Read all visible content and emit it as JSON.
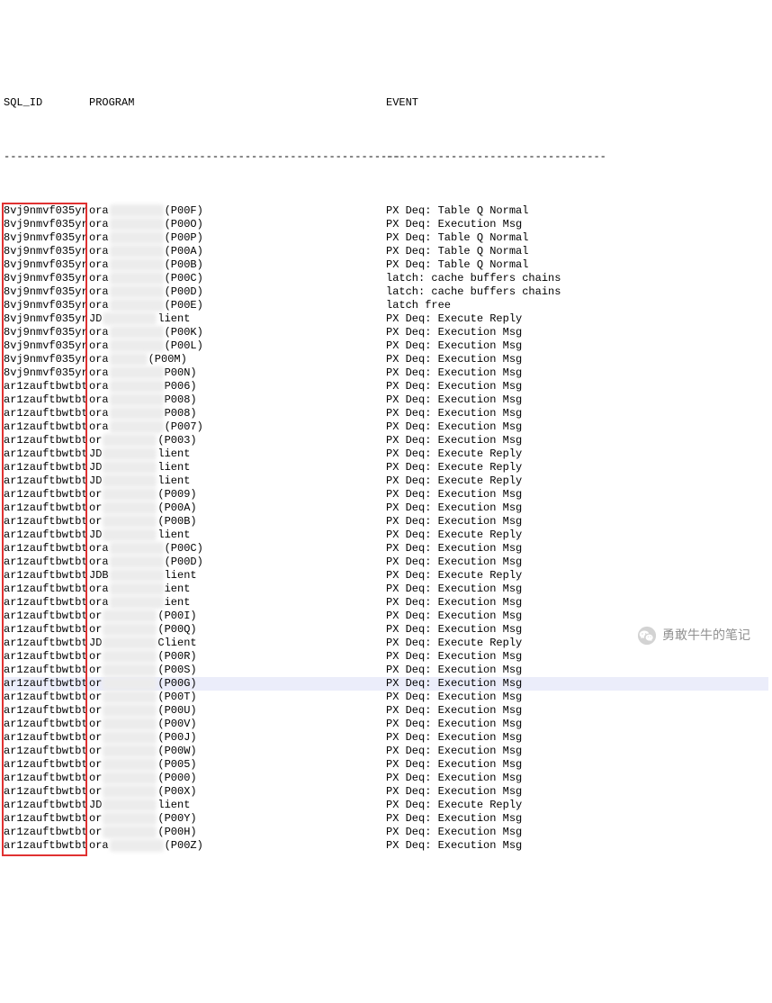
{
  "headers": {
    "sql_id": "SQL_ID",
    "program": "PROGRAM",
    "event": "EVENT"
  },
  "dashes": {
    "sql_id": "-------------",
    "program": "------------------------------------------------",
    "event": "----------------------------------"
  },
  "watermark": "勇敢牛牛的笔记",
  "highlighted_row_index": 35,
  "rows": [
    {
      "sql_id": "8vj9nmvf035yr",
      "prog_left": "ora",
      "prog_mid_type": "blur",
      "prog_right": "(P00F)",
      "event": "PX Deq: Table Q Normal"
    },
    {
      "sql_id": "8vj9nmvf035yr",
      "prog_left": "ora",
      "prog_mid_type": "blur",
      "prog_right": "(P00O)",
      "event": "PX Deq: Execution Msg"
    },
    {
      "sql_id": "8vj9nmvf035yr",
      "prog_left": "ora",
      "prog_mid_type": "blur",
      "prog_right": "(P00P)",
      "event": "PX Deq: Table Q Normal"
    },
    {
      "sql_id": "8vj9nmvf035yr",
      "prog_left": "ora",
      "prog_mid_type": "blur",
      "prog_right": "(P00A)",
      "event": "PX Deq: Table Q Normal"
    },
    {
      "sql_id": "8vj9nmvf035yr",
      "prog_left": "ora",
      "prog_mid_type": "blur",
      "prog_right": "(P00B)",
      "event": "PX Deq: Table Q Normal"
    },
    {
      "sql_id": "8vj9nmvf035yr",
      "prog_left": "ora",
      "prog_mid_type": "blur",
      "prog_right": "(P00C)",
      "event": "latch: cache buffers chains"
    },
    {
      "sql_id": "8vj9nmvf035yr",
      "prog_left": "ora",
      "prog_mid_type": "blur",
      "prog_right": "(P00D)",
      "event": "latch: cache buffers chains"
    },
    {
      "sql_id": "8vj9nmvf035yr",
      "prog_left": "ora",
      "prog_mid_type": "blur",
      "prog_right": "(P00E)",
      "event": "latch free"
    },
    {
      "sql_id": "8vj9nmvf035yr",
      "prog_left": "JD",
      "prog_mid_type": "blur",
      "prog_right": "lient",
      "event": "PX Deq: Execute Reply"
    },
    {
      "sql_id": "8vj9nmvf035yr",
      "prog_left": "ora",
      "prog_mid_type": "blur",
      "prog_right": "(P00K)",
      "event": "PX Deq: Execution Msg"
    },
    {
      "sql_id": "8vj9nmvf035yr",
      "prog_left": "ora",
      "prog_mid_type": "blur",
      "prog_right": "(P00L)",
      "event": "PX Deq: Execution Msg"
    },
    {
      "sql_id": "8vj9nmvf035yr",
      "prog_left": "ora",
      "prog_mid_type": "blur-small",
      "prog_right": "(P00M)",
      "event": "PX Deq: Execution Msg"
    },
    {
      "sql_id": "8vj9nmvf035yr",
      "prog_left": "ora",
      "prog_mid_type": "blur",
      "prog_right": "P00N)",
      "event": "PX Deq: Execution Msg"
    },
    {
      "sql_id": "ar1zauftbwtbt",
      "prog_left": "ora",
      "prog_mid_type": "blur",
      "prog_right": "P006)",
      "event": "PX Deq: Execution Msg"
    },
    {
      "sql_id": "ar1zauftbwtbt",
      "prog_left": "ora",
      "prog_mid_type": "blur",
      "prog_right": "P008)",
      "event": "PX Deq: Execution Msg"
    },
    {
      "sql_id": "ar1zauftbwtbt",
      "prog_left": "ora",
      "prog_mid_type": "blur",
      "prog_right": "P008)",
      "event": "PX Deq: Execution Msg"
    },
    {
      "sql_id": "ar1zauftbwtbt",
      "prog_left": "ora",
      "prog_mid_type": "blur",
      "prog_right": "(P007)",
      "event": "PX Deq: Execution Msg"
    },
    {
      "sql_id": "ar1zauftbwtbt",
      "prog_left": "or",
      "prog_mid_type": "blur",
      "prog_right": "(P003)",
      "event": "PX Deq: Execution Msg"
    },
    {
      "sql_id": "ar1zauftbwtbt",
      "prog_left": "JD",
      "prog_mid_type": "blur",
      "prog_right": "lient",
      "event": "PX Deq: Execute Reply"
    },
    {
      "sql_id": "ar1zauftbwtbt",
      "prog_left": "JD",
      "prog_mid_type": "blur",
      "prog_right": "lient",
      "event": "PX Deq: Execute Reply"
    },
    {
      "sql_id": "ar1zauftbwtbt",
      "prog_left": "JD",
      "prog_mid_type": "blur",
      "prog_right": "lient",
      "event": "PX Deq: Execute Reply"
    },
    {
      "sql_id": "ar1zauftbwtbt",
      "prog_left": "or",
      "prog_mid_type": "blur",
      "prog_right": "(P009)",
      "event": "PX Deq: Execution Msg"
    },
    {
      "sql_id": "ar1zauftbwtbt",
      "prog_left": "or",
      "prog_mid_type": "blur",
      "prog_right": "(P00A)",
      "event": "PX Deq: Execution Msg"
    },
    {
      "sql_id": "ar1zauftbwtbt",
      "prog_left": "or",
      "prog_mid_type": "blur",
      "prog_right": "(P00B)",
      "event": "PX Deq: Execution Msg"
    },
    {
      "sql_id": "ar1zauftbwtbt",
      "prog_left": "JD",
      "prog_mid_type": "blur",
      "prog_right": "lient",
      "event": "PX Deq: Execute Reply"
    },
    {
      "sql_id": "ar1zauftbwtbt",
      "prog_left": "ora",
      "prog_mid_type": "blur",
      "prog_right": "(P00C)",
      "event": "PX Deq: Execution Msg"
    },
    {
      "sql_id": "ar1zauftbwtbt",
      "prog_left": "ora",
      "prog_mid_type": "blur",
      "prog_right": "(P00D)",
      "event": "PX Deq: Execution Msg"
    },
    {
      "sql_id": "ar1zauftbwtbt",
      "prog_left": "JDB",
      "prog_mid_type": "blur",
      "prog_right": "lient",
      "event": "PX Deq: Execute Reply"
    },
    {
      "sql_id": "ar1zauftbwtbt",
      "prog_left": "ora",
      "prog_mid_type": "blur",
      "prog_right": "ient",
      "event": "PX Deq: Execution Msg"
    },
    {
      "sql_id": "ar1zauftbwtbt",
      "prog_left": "ora",
      "prog_mid_type": "blur",
      "prog_right": "ient",
      "event": "PX Deq: Execution Msg"
    },
    {
      "sql_id": "ar1zauftbwtbt",
      "prog_left": "or",
      "prog_mid_type": "blur",
      "prog_right": "(P00I)",
      "event": "PX Deq: Execution Msg"
    },
    {
      "sql_id": "ar1zauftbwtbt",
      "prog_left": "or",
      "prog_mid_type": "blur",
      "prog_right": "(P00Q)",
      "event": "PX Deq: Execution Msg"
    },
    {
      "sql_id": "ar1zauftbwtbt",
      "prog_left": "JD",
      "prog_mid_type": "blur",
      "prog_right": "Client",
      "event": "PX Deq: Execute Reply"
    },
    {
      "sql_id": "ar1zauftbwtbt",
      "prog_left": "or",
      "prog_mid_type": "blur",
      "prog_right": "(P00R)",
      "event": "PX Deq: Execution Msg"
    },
    {
      "sql_id": "ar1zauftbwtbt",
      "prog_left": "or",
      "prog_mid_type": "blur",
      "prog_right": "(P00S)",
      "event": "PX Deq: Execution Msg"
    },
    {
      "sql_id": "ar1zauftbwtbt",
      "prog_left": "or",
      "prog_mid_type": "blur",
      "prog_right": "(P00G)",
      "event": "PX Deq: Execution Msg"
    },
    {
      "sql_id": "ar1zauftbwtbt",
      "prog_left": "or",
      "prog_mid_type": "blur",
      "prog_right": "(P00T)",
      "event": "PX Deq: Execution Msg"
    },
    {
      "sql_id": "ar1zauftbwtbt",
      "prog_left": "or",
      "prog_mid_type": "blur",
      "prog_right": "(P00U)",
      "event": "PX Deq: Execution Msg"
    },
    {
      "sql_id": "ar1zauftbwtbt",
      "prog_left": "or",
      "prog_mid_type": "blur",
      "prog_right": "(P00V)",
      "event": "PX Deq: Execution Msg"
    },
    {
      "sql_id": "ar1zauftbwtbt",
      "prog_left": "or",
      "prog_mid_type": "blur",
      "prog_right": "(P00J)",
      "event": "PX Deq: Execution Msg"
    },
    {
      "sql_id": "ar1zauftbwtbt",
      "prog_left": "or",
      "prog_mid_type": "blur",
      "prog_right": "(P00W)",
      "event": "PX Deq: Execution Msg"
    },
    {
      "sql_id": "ar1zauftbwtbt",
      "prog_left": "or",
      "prog_mid_type": "blur",
      "prog_right": "(P005)",
      "event": "PX Deq: Execution Msg"
    },
    {
      "sql_id": "ar1zauftbwtbt",
      "prog_left": "or",
      "prog_mid_type": "blur",
      "prog_right": "(P000)",
      "event": "PX Deq: Execution Msg"
    },
    {
      "sql_id": "ar1zauftbwtbt",
      "prog_left": "or",
      "prog_mid_type": "blur",
      "prog_right": "(P00X)",
      "event": "PX Deq: Execution Msg"
    },
    {
      "sql_id": "ar1zauftbwtbt",
      "prog_left": "JD",
      "prog_mid_type": "blur",
      "prog_right": "lient",
      "event": "PX Deq: Execute Reply"
    },
    {
      "sql_id": "ar1zauftbwtbt",
      "prog_left": "or",
      "prog_mid_type": "blur",
      "prog_right": "(P00Y)",
      "event": "PX Deq: Execution Msg"
    },
    {
      "sql_id": "ar1zauftbwtbt",
      "prog_left": "or",
      "prog_mid_type": "blur",
      "prog_right": "(P00H)",
      "event": "PX Deq: Execution Msg"
    },
    {
      "sql_id": "ar1zauftbwtbt",
      "prog_left": "ora",
      "prog_mid_type": "blur",
      "prog_right": "(P00Z)",
      "event": "PX Deq: Execution Msg"
    }
  ]
}
